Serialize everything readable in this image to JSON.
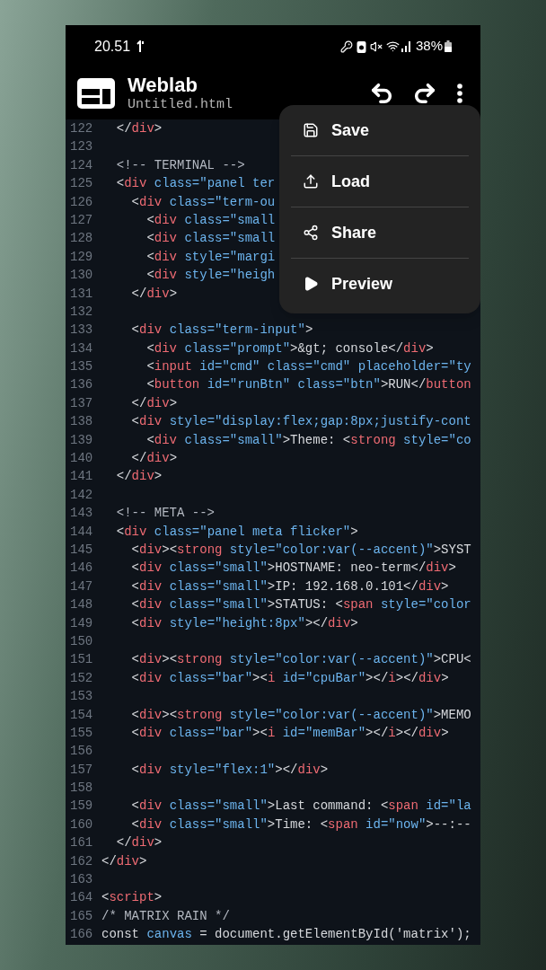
{
  "status_bar": {
    "time": "20.51",
    "battery_percent": "38%"
  },
  "app_bar": {
    "title": "Weblab",
    "filename": "Untitled.html"
  },
  "editor": {
    "lines": [
      {
        "number": "122",
        "segments": [
          {
            "kind": "plain",
            "text": "  </"
          },
          {
            "kind": "tag",
            "text": "div"
          },
          {
            "kind": "plain",
            "text": ">"
          }
        ]
      },
      {
        "number": "123"
      },
      {
        "number": "124",
        "segments": [
          {
            "kind": "comment",
            "text": "  <!-- TERMINAL -->"
          }
        ]
      },
      {
        "number": "125",
        "segments": [
          {
            "kind": "plain",
            "text": "  <"
          },
          {
            "kind": "tag",
            "text": "div"
          },
          {
            "kind": "attr",
            "text": " class=\"panel ter"
          }
        ]
      },
      {
        "number": "126",
        "segments": [
          {
            "kind": "plain",
            "text": "    <"
          },
          {
            "kind": "tag",
            "text": "div"
          },
          {
            "kind": "attr",
            "text": " class=\"term-ou"
          }
        ]
      },
      {
        "number": "127",
        "segments": [
          {
            "kind": "plain",
            "text": "      <"
          },
          {
            "kind": "tag",
            "text": "div"
          },
          {
            "kind": "attr",
            "text": " class=\"small"
          }
        ]
      },
      {
        "number": "128",
        "segments": [
          {
            "kind": "plain",
            "text": "      <"
          },
          {
            "kind": "tag",
            "text": "div"
          },
          {
            "kind": "attr",
            "text": " class=\"small"
          }
        ]
      },
      {
        "number": "129",
        "segments": [
          {
            "kind": "plain",
            "text": "      <"
          },
          {
            "kind": "tag",
            "text": "div"
          },
          {
            "kind": "attr",
            "text": " style=\"margi"
          }
        ]
      },
      {
        "number": "130",
        "segments": [
          {
            "kind": "plain",
            "text": "      <"
          },
          {
            "kind": "tag",
            "text": "div"
          },
          {
            "kind": "attr",
            "text": " style=\"heigh"
          }
        ]
      },
      {
        "number": "131",
        "segments": [
          {
            "kind": "plain",
            "text": "    </"
          },
          {
            "kind": "tag",
            "text": "div"
          },
          {
            "kind": "plain",
            "text": ">"
          }
        ]
      },
      {
        "number": "132"
      },
      {
        "number": "133",
        "segments": [
          {
            "kind": "plain",
            "text": "    <"
          },
          {
            "kind": "tag",
            "text": "div"
          },
          {
            "kind": "attr",
            "text": " class=\"term-input\""
          },
          {
            "kind": "plain",
            "text": ">"
          }
        ]
      },
      {
        "number": "134",
        "segments": [
          {
            "kind": "plain",
            "text": "      <"
          },
          {
            "kind": "tag",
            "text": "div"
          },
          {
            "kind": "attr",
            "text": " class=\"prompt\""
          },
          {
            "kind": "plain",
            "text": ">&gt; console</"
          },
          {
            "kind": "tag",
            "text": "div"
          },
          {
            "kind": "plain",
            "text": ">"
          }
        ]
      },
      {
        "number": "135",
        "segments": [
          {
            "kind": "plain",
            "text": "      <"
          },
          {
            "kind": "tag",
            "text": "input"
          },
          {
            "kind": "attr",
            "text": " id=\"cmd\" class=\"cmd\" placeholder=\"ty"
          }
        ]
      },
      {
        "number": "136",
        "segments": [
          {
            "kind": "plain",
            "text": "      <"
          },
          {
            "kind": "tag",
            "text": "button"
          },
          {
            "kind": "attr",
            "text": " id=\"runBtn\" class=\"btn\""
          },
          {
            "kind": "plain",
            "text": ">RUN</"
          },
          {
            "kind": "tag",
            "text": "button"
          }
        ]
      },
      {
        "number": "137",
        "segments": [
          {
            "kind": "plain",
            "text": "    </"
          },
          {
            "kind": "tag",
            "text": "div"
          },
          {
            "kind": "plain",
            "text": ">"
          }
        ]
      },
      {
        "number": "138",
        "segments": [
          {
            "kind": "plain",
            "text": "    <"
          },
          {
            "kind": "tag",
            "text": "div"
          },
          {
            "kind": "attr",
            "text": " style=\"display:flex;gap:8px;justify-cont"
          }
        ]
      },
      {
        "number": "139",
        "segments": [
          {
            "kind": "plain",
            "text": "      <"
          },
          {
            "kind": "tag",
            "text": "div"
          },
          {
            "kind": "attr",
            "text": " class=\"small\""
          },
          {
            "kind": "plain",
            "text": ">Theme: <"
          },
          {
            "kind": "tag",
            "text": "strong"
          },
          {
            "kind": "attr",
            "text": " style=\"co"
          }
        ]
      },
      {
        "number": "140",
        "segments": [
          {
            "kind": "plain",
            "text": "    </"
          },
          {
            "kind": "tag",
            "text": "div"
          },
          {
            "kind": "plain",
            "text": ">"
          }
        ]
      },
      {
        "number": "141",
        "segments": [
          {
            "kind": "plain",
            "text": "  </"
          },
          {
            "kind": "tag",
            "text": "div"
          },
          {
            "kind": "plain",
            "text": ">"
          }
        ]
      },
      {
        "number": "142"
      },
      {
        "number": "143",
        "segments": [
          {
            "kind": "comment",
            "text": "  <!-- META -->"
          }
        ]
      },
      {
        "number": "144",
        "segments": [
          {
            "kind": "plain",
            "text": "  <"
          },
          {
            "kind": "tag",
            "text": "div"
          },
          {
            "kind": "attr",
            "text": " class=\"panel meta flicker\""
          },
          {
            "kind": "plain",
            "text": ">"
          }
        ]
      },
      {
        "number": "145",
        "segments": [
          {
            "kind": "plain",
            "text": "    <"
          },
          {
            "kind": "tag",
            "text": "div"
          },
          {
            "kind": "plain",
            "text": "><"
          },
          {
            "kind": "tag",
            "text": "strong"
          },
          {
            "kind": "attr",
            "text": " style=\"color:var(--accent)\""
          },
          {
            "kind": "plain",
            "text": ">SYST"
          }
        ]
      },
      {
        "number": "146",
        "segments": [
          {
            "kind": "plain",
            "text": "    <"
          },
          {
            "kind": "tag",
            "text": "div"
          },
          {
            "kind": "attr",
            "text": " class=\"small\""
          },
          {
            "kind": "plain",
            "text": ">HOSTNAME: neo-term</"
          },
          {
            "kind": "tag",
            "text": "div"
          },
          {
            "kind": "plain",
            "text": ">"
          }
        ]
      },
      {
        "number": "147",
        "segments": [
          {
            "kind": "plain",
            "text": "    <"
          },
          {
            "kind": "tag",
            "text": "div"
          },
          {
            "kind": "attr",
            "text": " class=\"small\""
          },
          {
            "kind": "plain",
            "text": ">IP: 192.168.0.101</"
          },
          {
            "kind": "tag",
            "text": "div"
          },
          {
            "kind": "plain",
            "text": ">"
          }
        ]
      },
      {
        "number": "148",
        "segments": [
          {
            "kind": "plain",
            "text": "    <"
          },
          {
            "kind": "tag",
            "text": "div"
          },
          {
            "kind": "attr",
            "text": " class=\"small\""
          },
          {
            "kind": "plain",
            "text": ">STATUS: <"
          },
          {
            "kind": "tag",
            "text": "span"
          },
          {
            "kind": "attr",
            "text": " style=\"color"
          }
        ]
      },
      {
        "number": "149",
        "segments": [
          {
            "kind": "plain",
            "text": "    <"
          },
          {
            "kind": "tag",
            "text": "div"
          },
          {
            "kind": "attr",
            "text": " style=\"height:8px\""
          },
          {
            "kind": "plain",
            "text": "></"
          },
          {
            "kind": "tag",
            "text": "div"
          },
          {
            "kind": "plain",
            "text": ">"
          }
        ]
      },
      {
        "number": "150"
      },
      {
        "number": "151",
        "segments": [
          {
            "kind": "plain",
            "text": "    <"
          },
          {
            "kind": "tag",
            "text": "div"
          },
          {
            "kind": "plain",
            "text": "><"
          },
          {
            "kind": "tag",
            "text": "strong"
          },
          {
            "kind": "attr",
            "text": " style=\"color:var(--accent)\""
          },
          {
            "kind": "plain",
            "text": ">CPU<"
          }
        ]
      },
      {
        "number": "152",
        "segments": [
          {
            "kind": "plain",
            "text": "    <"
          },
          {
            "kind": "tag",
            "text": "div"
          },
          {
            "kind": "attr",
            "text": " class=\"bar\""
          },
          {
            "kind": "plain",
            "text": "><"
          },
          {
            "kind": "tag",
            "text": "i"
          },
          {
            "kind": "attr",
            "text": " id=\"cpuBar\""
          },
          {
            "kind": "plain",
            "text": "></"
          },
          {
            "kind": "tag",
            "text": "i"
          },
          {
            "kind": "plain",
            "text": "></"
          },
          {
            "kind": "tag",
            "text": "div"
          },
          {
            "kind": "plain",
            "text": ">"
          }
        ]
      },
      {
        "number": "153"
      },
      {
        "number": "154",
        "segments": [
          {
            "kind": "plain",
            "text": "    <"
          },
          {
            "kind": "tag",
            "text": "div"
          },
          {
            "kind": "plain",
            "text": "><"
          },
          {
            "kind": "tag",
            "text": "strong"
          },
          {
            "kind": "attr",
            "text": " style=\"color:var(--accent)\""
          },
          {
            "kind": "plain",
            "text": ">MEMO"
          }
        ]
      },
      {
        "number": "155",
        "segments": [
          {
            "kind": "plain",
            "text": "    <"
          },
          {
            "kind": "tag",
            "text": "div"
          },
          {
            "kind": "attr",
            "text": " class=\"bar\""
          },
          {
            "kind": "plain",
            "text": "><"
          },
          {
            "kind": "tag",
            "text": "i"
          },
          {
            "kind": "attr",
            "text": " id=\"memBar\""
          },
          {
            "kind": "plain",
            "text": "></"
          },
          {
            "kind": "tag",
            "text": "i"
          },
          {
            "kind": "plain",
            "text": "></"
          },
          {
            "kind": "tag",
            "text": "div"
          },
          {
            "kind": "plain",
            "text": ">"
          }
        ]
      },
      {
        "number": "156"
      },
      {
        "number": "157",
        "segments": [
          {
            "kind": "plain",
            "text": "    <"
          },
          {
            "kind": "tag",
            "text": "div"
          },
          {
            "kind": "attr",
            "text": " style=\"flex:1\""
          },
          {
            "kind": "plain",
            "text": "></"
          },
          {
            "kind": "tag",
            "text": "div"
          },
          {
            "kind": "plain",
            "text": ">"
          }
        ]
      },
      {
        "number": "158"
      },
      {
        "number": "159",
        "segments": [
          {
            "kind": "plain",
            "text": "    <"
          },
          {
            "kind": "tag",
            "text": "div"
          },
          {
            "kind": "attr",
            "text": " class=\"small\""
          },
          {
            "kind": "plain",
            "text": ">Last command: <"
          },
          {
            "kind": "tag",
            "text": "span"
          },
          {
            "kind": "attr",
            "text": " id=\"la"
          }
        ]
      },
      {
        "number": "160",
        "segments": [
          {
            "kind": "plain",
            "text": "    <"
          },
          {
            "kind": "tag",
            "text": "div"
          },
          {
            "kind": "attr",
            "text": " class=\"small\""
          },
          {
            "kind": "plain",
            "text": ">Time: <"
          },
          {
            "kind": "tag",
            "text": "span"
          },
          {
            "kind": "attr",
            "text": " id=\"now\""
          },
          {
            "kind": "plain",
            "text": ">--:--"
          }
        ]
      },
      {
        "number": "161",
        "segments": [
          {
            "kind": "plain",
            "text": "  </"
          },
          {
            "kind": "tag",
            "text": "div"
          },
          {
            "kind": "plain",
            "text": ">"
          }
        ]
      },
      {
        "number": "162",
        "segments": [
          {
            "kind": "plain",
            "text": "</"
          },
          {
            "kind": "tag",
            "text": "div"
          },
          {
            "kind": "plain",
            "text": ">"
          }
        ]
      },
      {
        "number": "163"
      },
      {
        "number": "164",
        "segments": [
          {
            "kind": "plain",
            "text": "<"
          },
          {
            "kind": "tag",
            "text": "script"
          },
          {
            "kind": "plain",
            "text": ">"
          }
        ]
      },
      {
        "number": "165",
        "segments": [
          {
            "kind": "comment",
            "text": "/* MATRIX RAIN */"
          }
        ]
      },
      {
        "number": "166",
        "segments": [
          {
            "kind": "plain",
            "text": "const "
          },
          {
            "kind": "attr",
            "text": "canvas"
          },
          {
            "kind": "plain",
            "text": " = document.getElementById('matrix');"
          }
        ]
      }
    ]
  },
  "menu": {
    "items": [
      {
        "label": "Save"
      },
      {
        "label": "Load"
      },
      {
        "label": "Share"
      },
      {
        "label": "Preview"
      }
    ]
  }
}
